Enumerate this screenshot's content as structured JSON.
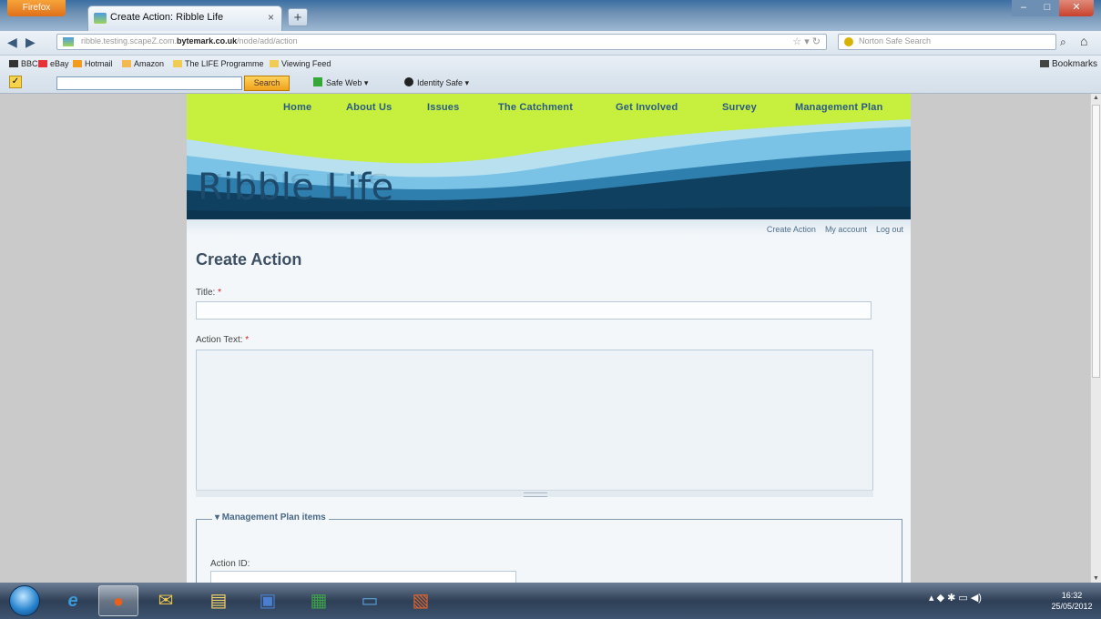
{
  "browser": {
    "app_button": "Firefox",
    "tab_title": "Create Action: Ribble Life",
    "tab_close": "×",
    "new_tab": "+",
    "url_prefix": "ribble.testing.scapeZ.com.",
    "url_domain": "bytemark.co.uk",
    "url_suffix": "/node/add/action",
    "search_placeholder": "Norton Safe Search",
    "bookmarks": [
      "BBC",
      "eBay",
      "Hotmail",
      "Amazon",
      "The LIFE Programme",
      "Viewing Feed"
    ],
    "bookmarks_right": "Bookmarks",
    "norton_search_button": "Search",
    "safe_web": "Safe Web ▾",
    "identity_safe": "Identity Safe ▾"
  },
  "site": {
    "title": "Ribble Life",
    "nav": [
      "Home",
      "About Us",
      "Issues",
      "The Catchment",
      "Get Involved",
      "Survey",
      "Management Plan"
    ],
    "user_links": [
      "Create Action",
      "My account",
      "Log out"
    ]
  },
  "form": {
    "page_title": "Create Action",
    "title_label": "Title:",
    "action_text_label": "Action Text:",
    "required_marker": "*",
    "fieldset_legend": "▾ Management Plan items",
    "action_id_label": "Action ID:"
  },
  "taskbar": {
    "clock_time": "16:32",
    "clock_date": "25/05/2012"
  },
  "colors": {
    "nav_green": "#c6ef3e",
    "nav_text": "#2a5a86",
    "banner_dark": "#0f4060",
    "title_blue": "#1e4a6c"
  }
}
